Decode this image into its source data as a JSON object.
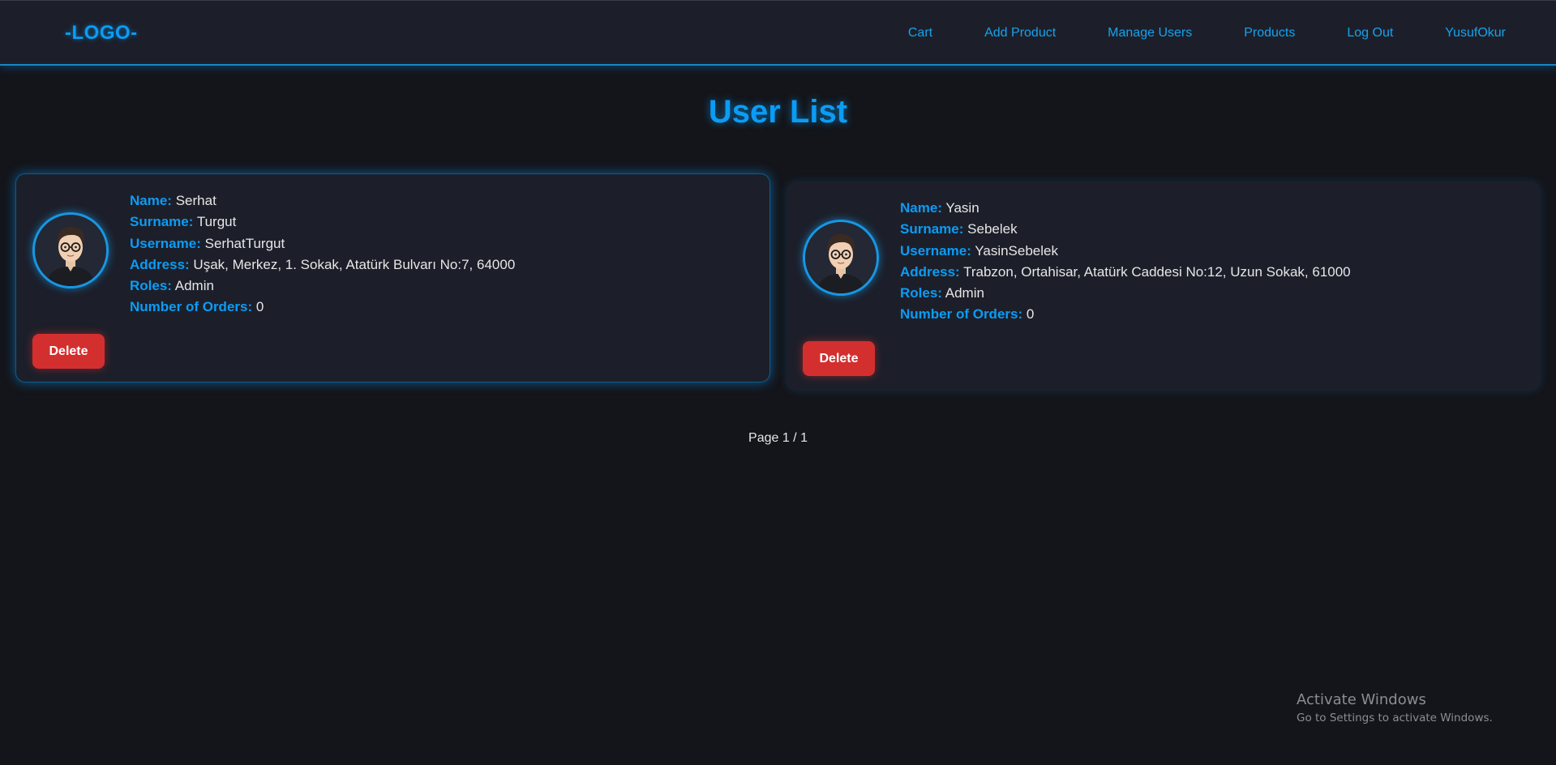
{
  "navbar": {
    "logo": "-LOGO-",
    "links": [
      {
        "label": "Cart"
      },
      {
        "label": "Add Product"
      },
      {
        "label": "Manage Users"
      },
      {
        "label": "Products"
      },
      {
        "label": "Log Out"
      },
      {
        "label": "YusufOkur"
      }
    ]
  },
  "page_title": "User List",
  "users": [
    {
      "name_label": "Name:",
      "name": "Serhat",
      "surname_label": "Surname:",
      "surname": "Turgut",
      "username_label": "Username:",
      "username": "SerhatTurgut",
      "address_label": "Address:",
      "address": "Uşak, Merkez, 1. Sokak, Atatürk Bulvarı No:7, 64000",
      "roles_label": "Roles:",
      "roles": "Admin",
      "orders_label": "Number of Orders:",
      "orders": "0",
      "delete_label": "Delete",
      "avatar_icon": "user-avatar-icon"
    },
    {
      "name_label": "Name:",
      "name": "Yasin",
      "surname_label": "Surname:",
      "surname": "Sebelek",
      "username_label": "Username:",
      "username": "YasinSebelek",
      "address_label": "Address:",
      "address": "Trabzon, Ortahisar, Atatürk Caddesi No:12, Uzun Sokak, 61000",
      "roles_label": "Roles:",
      "roles": "Admin",
      "orders_label": "Number of Orders:",
      "orders": "0",
      "delete_label": "Delete",
      "avatar_icon": "user-avatar-icon"
    }
  ],
  "pagination": {
    "text": "Page 1 / 1"
  },
  "watermark": {
    "title": "Activate Windows",
    "subtitle": "Go to Settings to activate Windows."
  },
  "colors": {
    "background": "#14151a",
    "surface": "#1c1f2a",
    "accent": "#0b9cf5",
    "danger": "#d32f2f",
    "text": "#e6e6e6"
  }
}
